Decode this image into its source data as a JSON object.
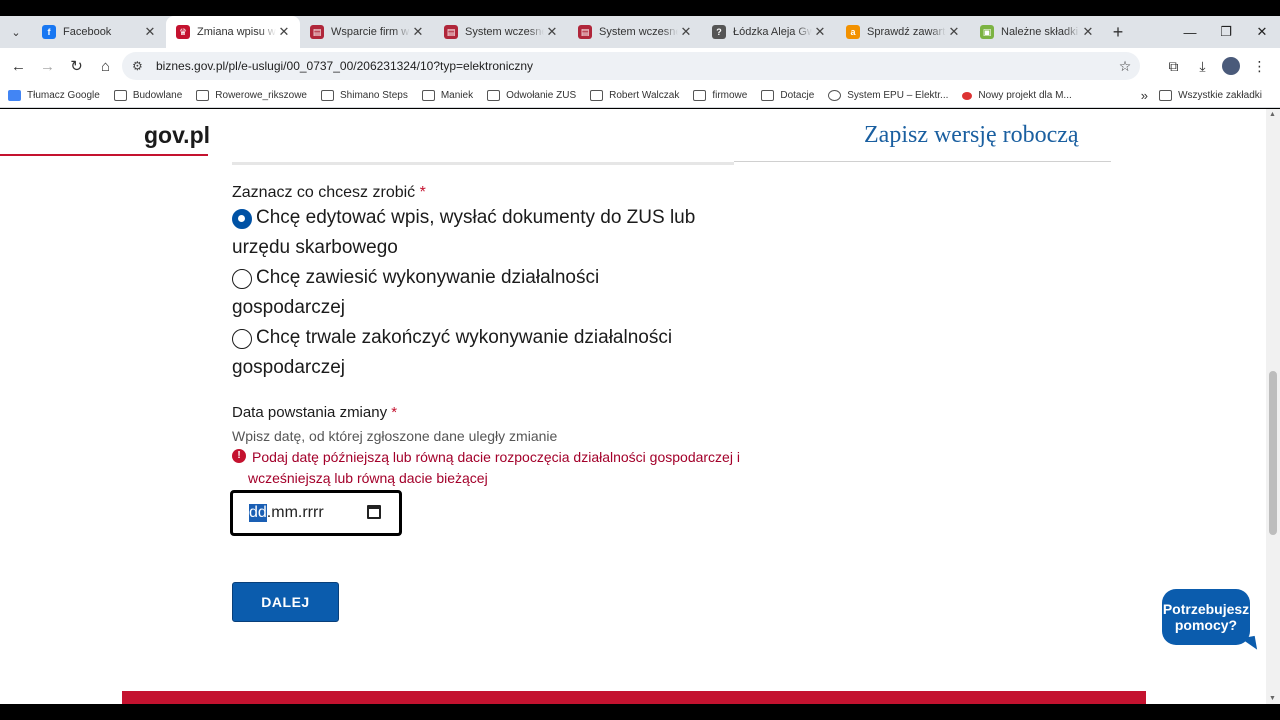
{
  "browser": {
    "tabs": [
      {
        "title": "Facebook",
        "active": false,
        "favicon_color": "#1877f2",
        "favicon_glyph": "f"
      },
      {
        "title": "Zmiana wpisu w CEIDG",
        "active": true,
        "favicon_color": "#c4122f",
        "favicon_glyph": "♛"
      },
      {
        "title": "Wsparcie firm w ciągu",
        "active": false,
        "favicon_color": "#b0263a",
        "favicon_glyph": "▤"
      },
      {
        "title": "System wczesnego ostrzegania",
        "active": false,
        "favicon_color": "#b0263a",
        "favicon_glyph": "▤"
      },
      {
        "title": "System wczesnego ostrzegania",
        "active": false,
        "favicon_color": "#b0263a",
        "favicon_glyph": "▤"
      },
      {
        "title": "Łódzka Aleja Gwiazd",
        "active": false,
        "favicon_color": "#555555",
        "favicon_glyph": "?"
      },
      {
        "title": "Sprawdź zawartość",
        "active": false,
        "favicon_color": "#f29100",
        "favicon_glyph": "a"
      },
      {
        "title": "Należne składki i wpłaty",
        "active": false,
        "favicon_color": "#7cb342",
        "favicon_glyph": "▣"
      }
    ],
    "url": "biznes.gov.pl/pl/e-uslugi/00_0737_00/206231324/10?typ=elektroniczny",
    "bookmarks": [
      {
        "label": "Tłumacz Google",
        "icon": "google-translate-icon"
      },
      {
        "label": "Budowlane",
        "icon": "folder-icon"
      },
      {
        "label": "Rowerowe_rikszowe",
        "icon": "folder-icon"
      },
      {
        "label": "Shimano Steps",
        "icon": "folder-icon"
      },
      {
        "label": "Maniek",
        "icon": "folder-icon"
      },
      {
        "label": "Odwołanie ZUS",
        "icon": "folder-icon"
      },
      {
        "label": "Robert Walczak",
        "icon": "folder-icon"
      },
      {
        "label": "firmowe",
        "icon": "folder-icon"
      },
      {
        "label": "Dotacje",
        "icon": "folder-icon"
      },
      {
        "label": "System EPU – Elektr...",
        "icon": "globe-icon"
      },
      {
        "label": "Nowy projekt dla M...",
        "icon": "red-bookmark-icon"
      }
    ],
    "all_bookmarks": "Wszystkie zakładki"
  },
  "header": {
    "logo": "gov.pl",
    "save_draft": "Zapisz wersję roboczą"
  },
  "form": {
    "action_legend": "Zaznacz co chcesz zrobić",
    "required_mark": "*",
    "options": [
      {
        "line1": "Chcę edytować wpis, wysłać dokumenty do ZUS lub",
        "line2": "urzędu skarbowego",
        "checked": true
      },
      {
        "line1": "Chcę zawiesić wykonywanie działalności",
        "line2": "gospodarczej",
        "checked": false
      },
      {
        "line1": "Chcę trwale zakończyć wykonywanie działalności",
        "line2": "gospodarczej",
        "checked": false
      }
    ],
    "date_label": "Data powstania zmiany",
    "date_hint": "Wpisz datę, od której zgłoszone dane uległy zmianie",
    "error_line1": "Podaj datę późniejszą lub równą dacie rozpoczęcia działalności gospodarczej i",
    "error_line2": "wcześniejszą lub równą dacie bieżącej",
    "date_placeholder_day": "dd",
    "date_placeholder_rest": ".mm.rrrr",
    "next_button": "DALEJ"
  },
  "help_bubble": {
    "line1": "Potrzebujesz",
    "line2": "pomocy?"
  },
  "colors": {
    "accent": "#0b5cad",
    "gov_red": "#c4122f",
    "error": "#a3002a"
  }
}
